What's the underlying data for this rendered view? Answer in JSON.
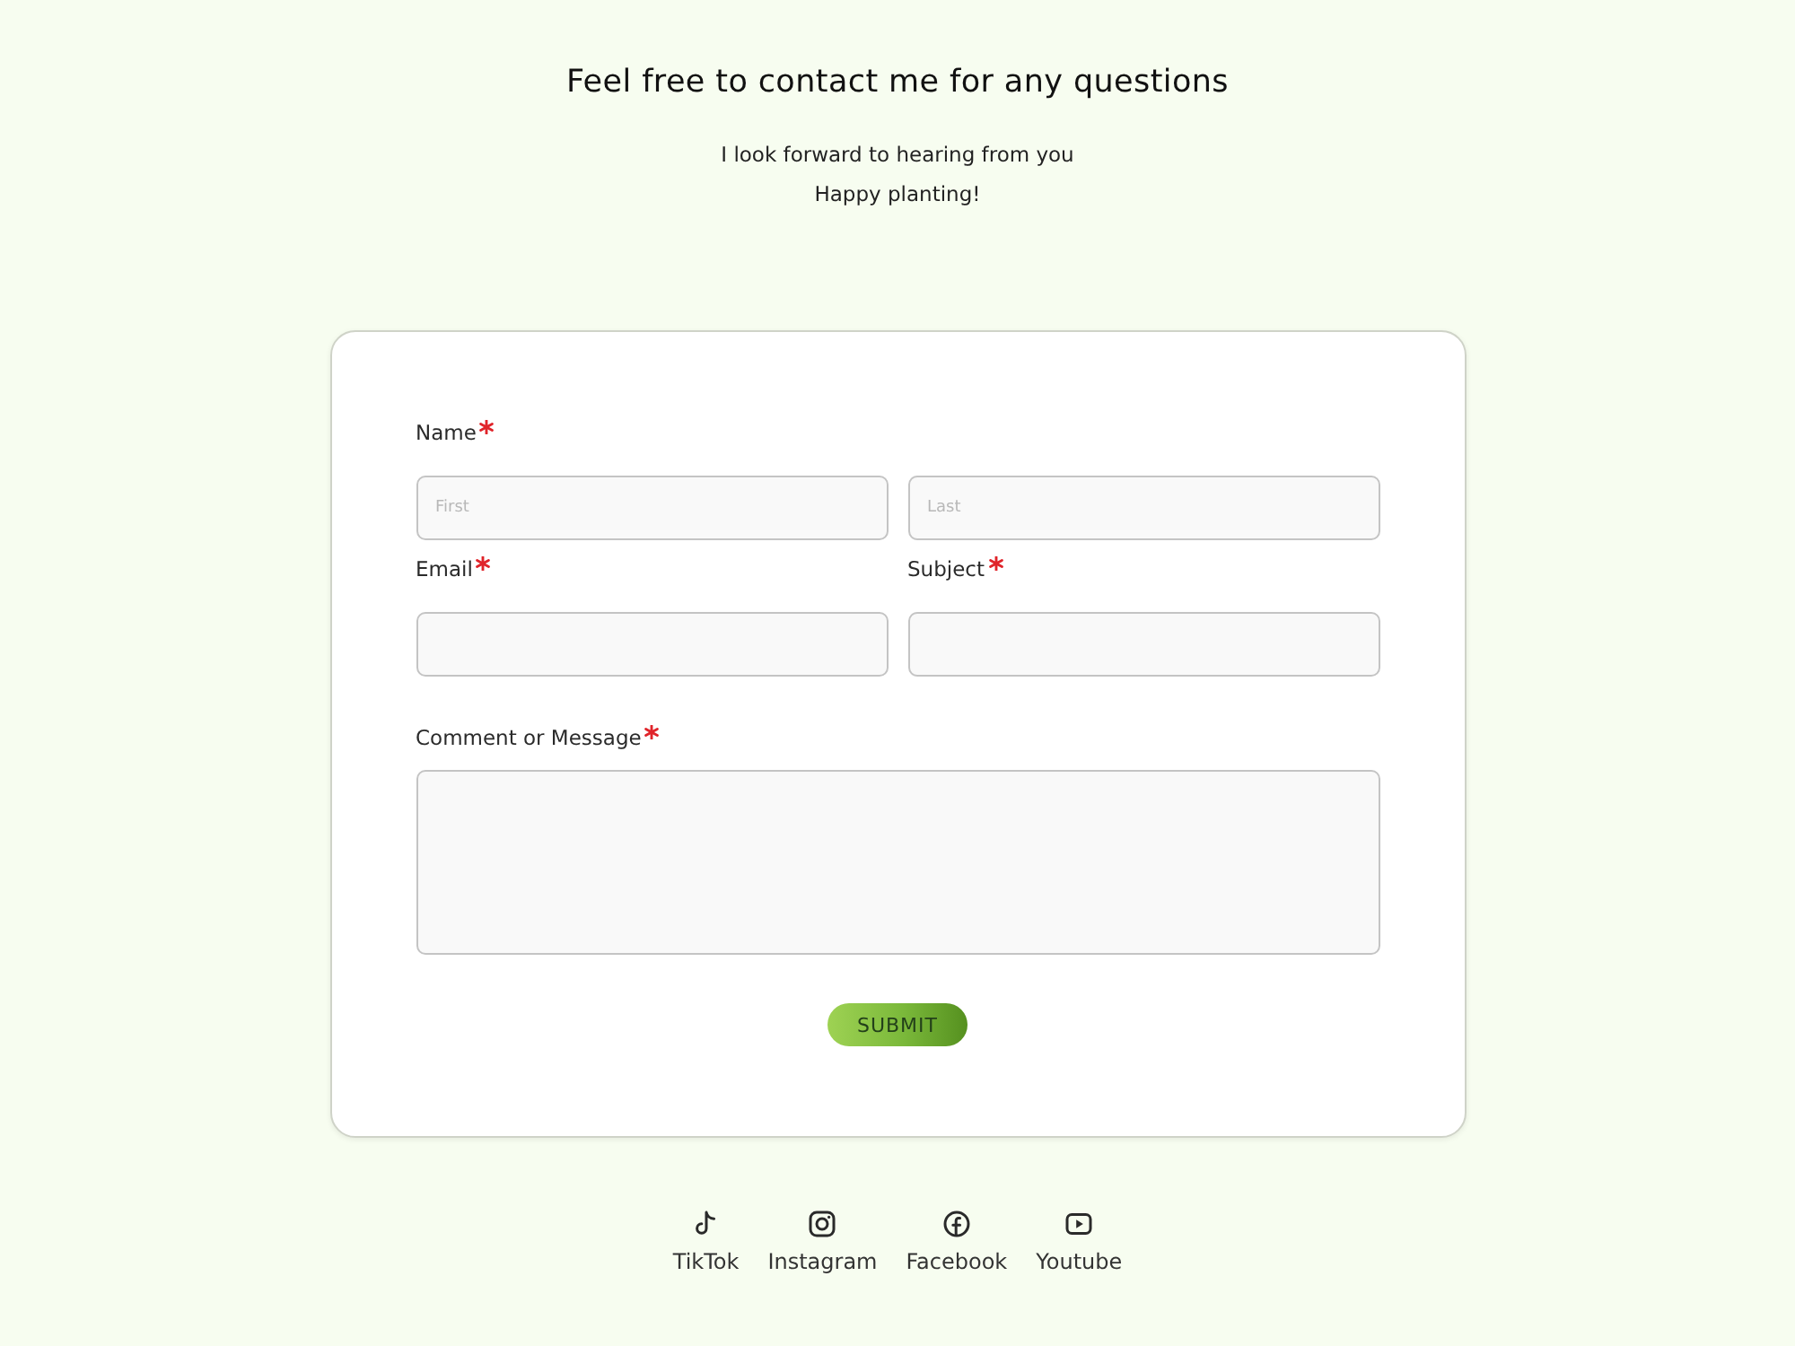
{
  "header": {
    "title": "Feel free to contact me for any questions",
    "lines": [
      "I look forward to hearing from you",
      "Happy planting!"
    ]
  },
  "form": {
    "fields": [
      {
        "kind": "name",
        "label": "Name",
        "required": true,
        "inputs": [
          {
            "placeholder": "First"
          },
          {
            "placeholder": "Last"
          }
        ]
      },
      {
        "kind": "text",
        "label": "Email",
        "required": true
      },
      {
        "kind": "text",
        "label": "Subject",
        "required": true
      },
      {
        "kind": "textarea",
        "label": "Comment or Message",
        "required": true
      }
    ],
    "submit": "SUBMIT"
  },
  "social_links": [
    {
      "kind": "tiktok",
      "label": "TikTok"
    },
    {
      "kind": "instagram",
      "label": "Instagram"
    },
    {
      "kind": "facebook",
      "label": "Facebook"
    },
    {
      "kind": "youtube",
      "label": "Youtube"
    }
  ]
}
